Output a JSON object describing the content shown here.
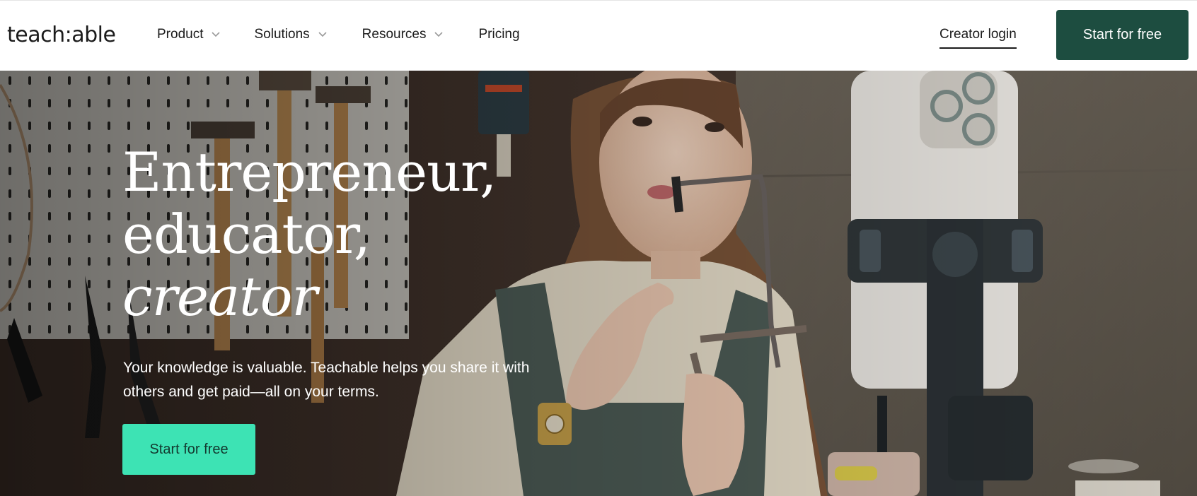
{
  "brand": {
    "logo_text": "teach:able"
  },
  "nav": {
    "items": [
      {
        "label": "Product",
        "has_dropdown": true
      },
      {
        "label": "Solutions",
        "has_dropdown": true
      },
      {
        "label": "Resources",
        "has_dropdown": true
      },
      {
        "label": "Pricing",
        "has_dropdown": false
      }
    ],
    "login_label": "Creator login",
    "cta_label": "Start for free"
  },
  "hero": {
    "headline": [
      "Entrepreneur,",
      "educator,",
      "creator"
    ],
    "subtext": "Your knowledge is valuable. Teachable helps you share it with others and get paid—all on your terms.",
    "cta_label": "Start for free",
    "image_description_icon": "video-background-icon"
  },
  "colors": {
    "header_cta_bg": "#1d4d40",
    "hero_cta_bg": "#3de3b4",
    "text_dark": "#1b1b1b"
  }
}
